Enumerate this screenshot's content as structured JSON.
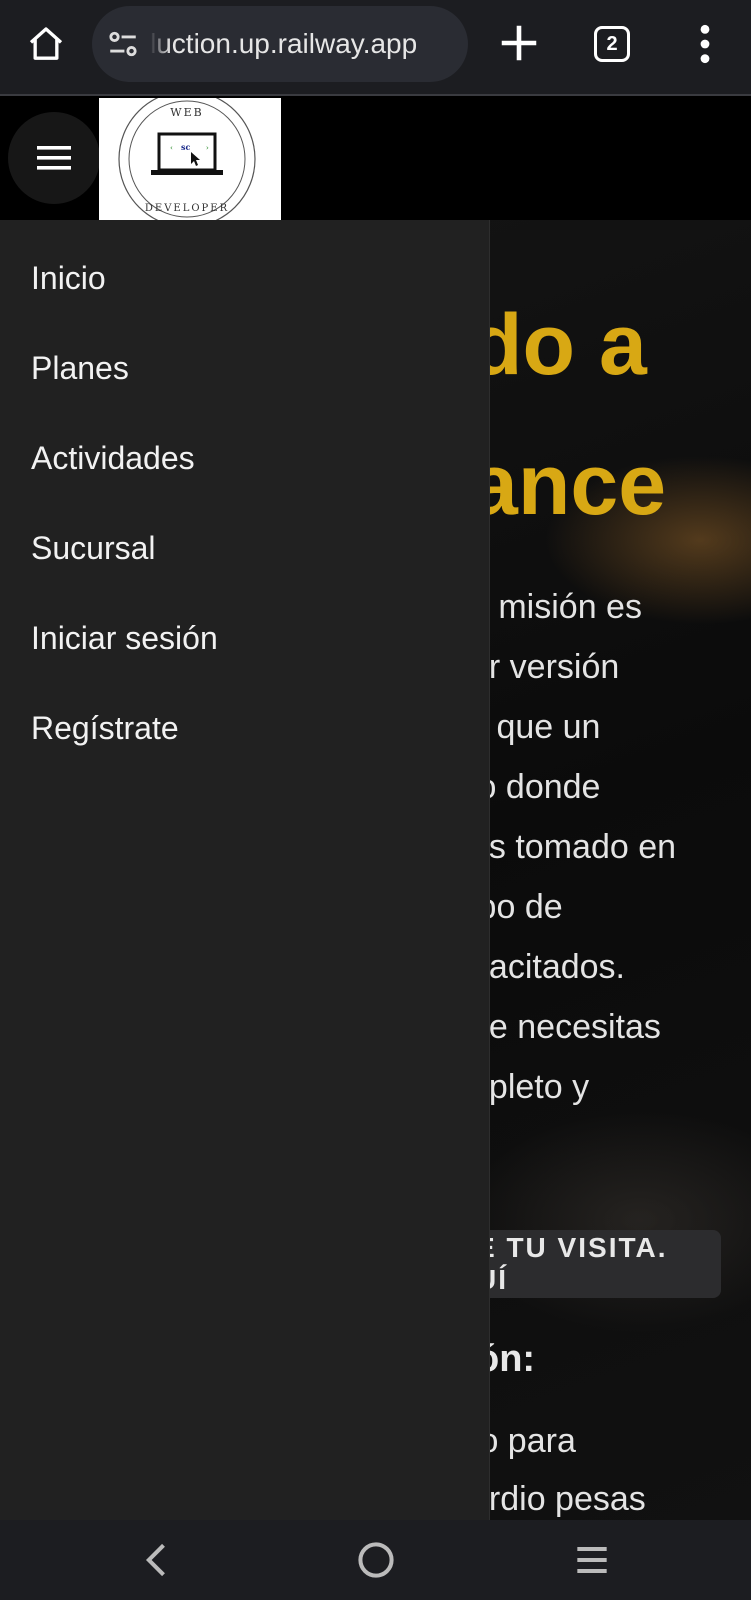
{
  "browser": {
    "url": "luction.up.railway.app",
    "tab_count": "2",
    "icons": {
      "home": "home-icon",
      "site_settings": "tune-icon",
      "new_tab": "plus-icon",
      "tabs": "tab-switcher-icon",
      "menu": "more-vert-icon"
    }
  },
  "site": {
    "logo_top_text": "WEB",
    "logo_bottom_text": "DEVELOPER",
    "logo_screen_text": "sc"
  },
  "drawer": {
    "items": [
      {
        "label": "Inicio"
      },
      {
        "label": "Planes"
      },
      {
        "label": "Actividades"
      },
      {
        "label": "Sucursal"
      },
      {
        "label": "Iniciar sesión"
      },
      {
        "label": "Regístrate"
      }
    ]
  },
  "hero": {
    "title_lines": [
      "do a",
      "ance"
    ],
    "paragraph_lines": [
      "a misión es",
      "or versión",
      "s que un",
      "io donde",
      "es tomado en",
      "ipo de",
      "pacitados.",
      "ue necesitas",
      "npleto y"
    ],
    "cta_lines": [
      "E TU VISITA.",
      "UÍ"
    ],
    "sub_heading": "ón:",
    "paragraph2_lines": [
      "to para",
      "ardio pesas"
    ]
  },
  "colors": {
    "accent": "#d8a814",
    "drawer_bg": "#212121",
    "browser_bg": "#1c1d21"
  }
}
